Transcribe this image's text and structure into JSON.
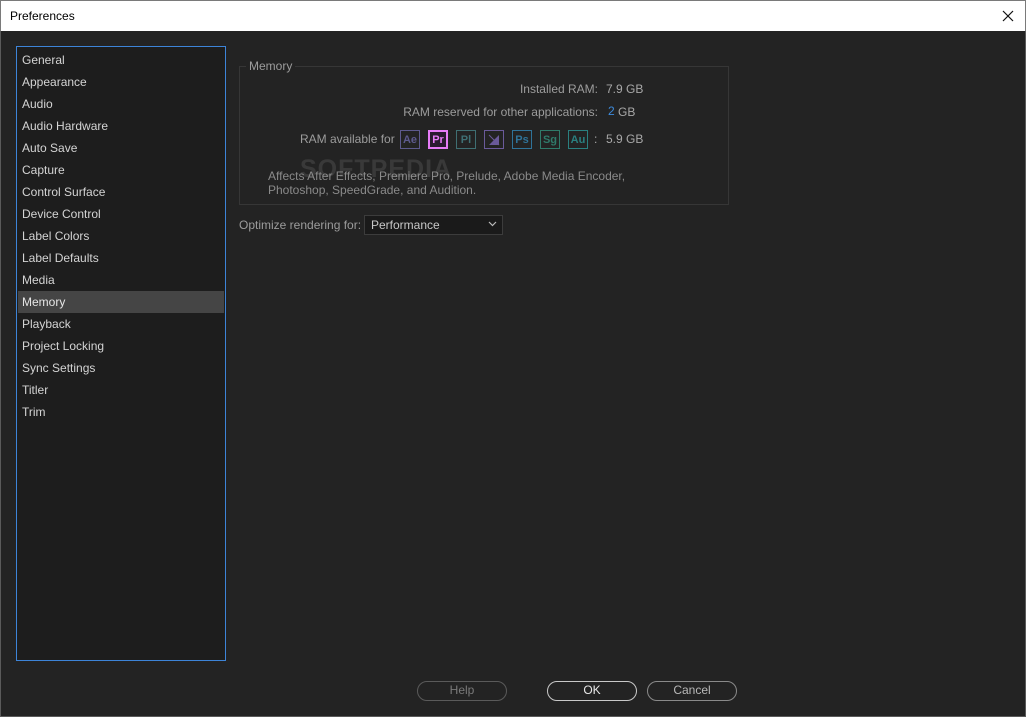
{
  "window": {
    "title": "Preferences"
  },
  "sidebar": {
    "items": [
      {
        "label": "General"
      },
      {
        "label": "Appearance"
      },
      {
        "label": "Audio"
      },
      {
        "label": "Audio Hardware"
      },
      {
        "label": "Auto Save"
      },
      {
        "label": "Capture"
      },
      {
        "label": "Control Surface"
      },
      {
        "label": "Device Control"
      },
      {
        "label": "Label Colors"
      },
      {
        "label": "Label Defaults"
      },
      {
        "label": "Media"
      },
      {
        "label": "Memory",
        "selected": true
      },
      {
        "label": "Playback"
      },
      {
        "label": "Project Locking"
      },
      {
        "label": "Sync Settings"
      },
      {
        "label": "Titler"
      },
      {
        "label": "Trim"
      }
    ]
  },
  "memory": {
    "group_title": "Memory",
    "installed_ram_label": "Installed RAM:",
    "installed_ram_value": "7.9 GB",
    "reserved_label": "RAM reserved for other applications:",
    "reserved_value": "2",
    "reserved_unit": "GB",
    "available_label": "RAM available for",
    "available_colon": ":",
    "available_value": "5.9 GB",
    "apps": [
      {
        "abbr": "Ae",
        "color": "#5d5a8e",
        "name": "after-effects-icon"
      },
      {
        "abbr": "Pr",
        "color": "#e77cf7",
        "name": "premiere-pro-icon",
        "active": true
      },
      {
        "abbr": "Pl",
        "color": "#3f6f73",
        "name": "prelude-icon"
      },
      {
        "abbr": "",
        "color": "#6a5a9a",
        "name": "media-encoder-icon"
      },
      {
        "abbr": "Ps",
        "color": "#2f7399",
        "name": "photoshop-icon"
      },
      {
        "abbr": "Sg",
        "color": "#2f7a6a",
        "name": "speedgrade-icon"
      },
      {
        "abbr": "Au",
        "color": "#2a8080",
        "name": "audition-icon"
      }
    ],
    "description": "Affects After Effects, Premiere Pro, Prelude, Adobe Media Encoder, Photoshop, SpeedGrade, and Audition."
  },
  "optimize": {
    "label": "Optimize rendering for:",
    "value": "Performance"
  },
  "buttons": {
    "help": "Help",
    "ok": "OK",
    "cancel": "Cancel"
  },
  "watermark": "SOFTPEDIA"
}
